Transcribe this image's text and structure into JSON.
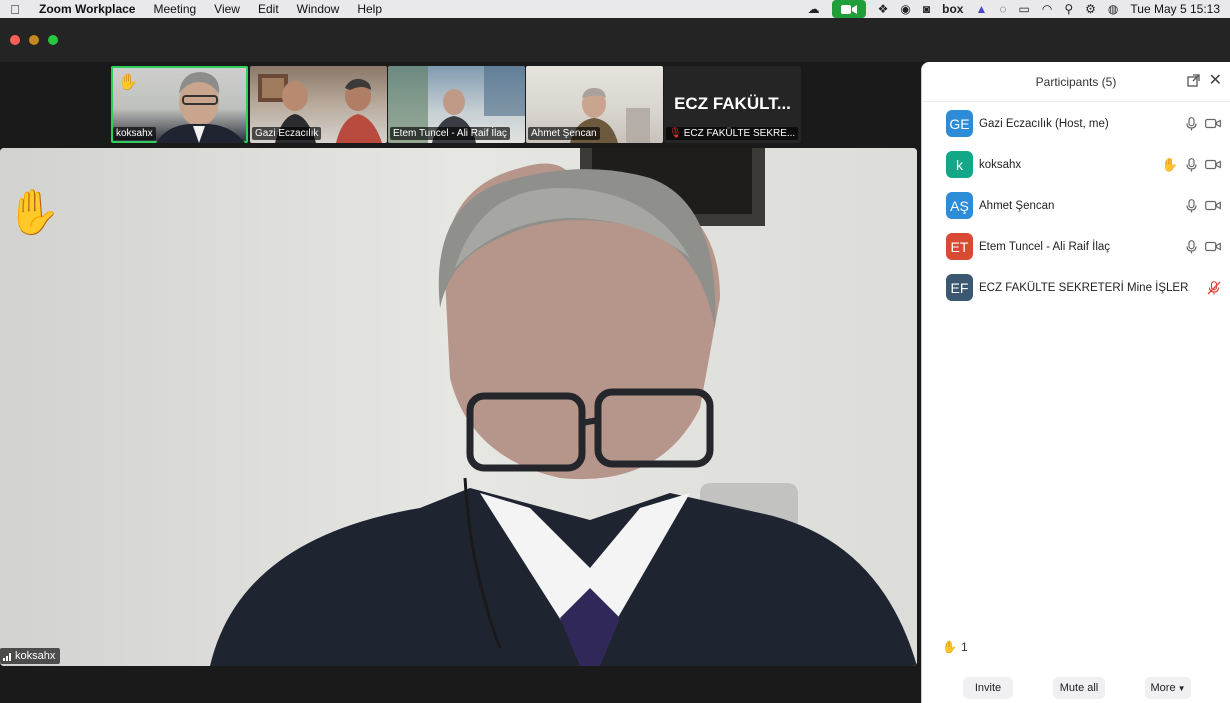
{
  "menubar": {
    "app_name": "Zoom Workplace",
    "items": [
      "Meeting",
      "View",
      "Edit",
      "Window",
      "Help"
    ],
    "box_label": "box",
    "datetime": "Tue May 5  15:13"
  },
  "gallery": [
    {
      "name": "koksahx",
      "active": true,
      "hand_raised": true
    },
    {
      "name": "Gazi Eczacılık"
    },
    {
      "name": "Etem Tuncel - Ali Raif İlaç"
    },
    {
      "name": "Ahmet Şencan"
    },
    {
      "name": "ECZ FAKÜLTE SEKRE...",
      "display_text": "ECZ FAKÜLT...",
      "muted": true
    }
  ],
  "main_video": {
    "speaker_name": "koksahx",
    "hand_raised": true
  },
  "panel": {
    "title": "Participants (5)",
    "participants": [
      {
        "initials": "GE",
        "name": "Gazi Eczacılık (Host, me)",
        "color": "#2d8cd8",
        "hand": false,
        "muted": false,
        "video": true
      },
      {
        "initials": "k",
        "name": "koksahx",
        "color": "#12a887",
        "hand": true,
        "muted": false,
        "video": true
      },
      {
        "initials": "AŞ",
        "name": "Ahmet Şencan",
        "color": "#2d8cd8",
        "hand": false,
        "muted": false,
        "video": true
      },
      {
        "initials": "ET",
        "name": "Etem Tuncel - Ali Raif İlaç",
        "color": "#d84a34",
        "hand": false,
        "muted": false,
        "video": true
      },
      {
        "initials": "EF",
        "name": "ECZ FAKÜLTE SEKRETERİ Mine İŞLER",
        "color": "#3b5872",
        "hand": false,
        "muted": true,
        "video": false
      }
    ],
    "raised_hands_count": "1",
    "buttons": {
      "invite": "Invite",
      "mute_all": "Mute all",
      "more": "More"
    }
  }
}
